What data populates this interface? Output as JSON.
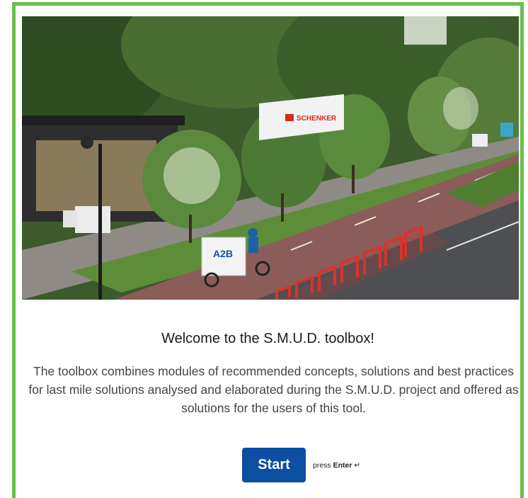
{
  "hero": {
    "truck_text": "SCHENKER",
    "bike_text": "A2B"
  },
  "welcome": {
    "title": "Welcome to the S.M.U.D. toolbox!",
    "description": "The toolbox combines modules of recommended concepts, solutions and best practices for last mile solutions analysed and elaborated during the S.M.U.D. project and offered as solutions for the users of this tool."
  },
  "actions": {
    "start_label": "Start",
    "hint_prefix": "press",
    "hint_key": "Enter",
    "hint_icon": "↵"
  },
  "colors": {
    "frame": "#6abf4b",
    "button": "#0b4ea2"
  }
}
